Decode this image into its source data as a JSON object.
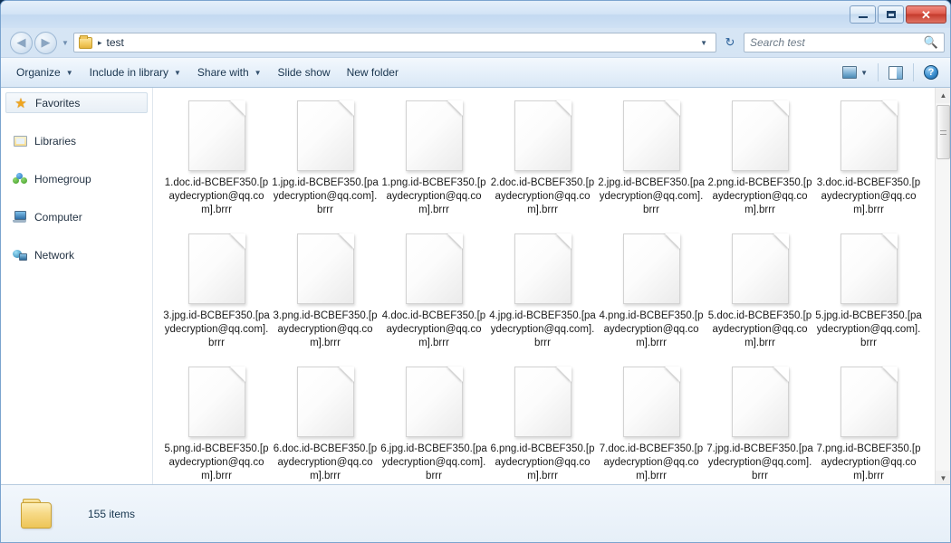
{
  "window": {
    "controls": {
      "minimize_label": "Minimize",
      "maximize_label": "Maximize",
      "close_label": "✕"
    }
  },
  "navigation": {
    "back_label": "◀",
    "forward_label": "▶",
    "history_caret": "▼",
    "refresh_label": "↻"
  },
  "address": {
    "folder_icon": "folder-icon",
    "separator": "▸",
    "crumb": "test",
    "dropdown_caret": "▼"
  },
  "search": {
    "placeholder": "Search test",
    "value": "",
    "icon": "search-icon"
  },
  "toolbar": {
    "organize_label": "Organize",
    "include_label": "Include in library",
    "share_label": "Share with",
    "slideshow_label": "Slide show",
    "newfolder_label": "New folder",
    "caret": "▼",
    "view_icon": "view-options-icon",
    "preview_icon": "preview-pane-icon",
    "help_icon": "help-icon",
    "help_glyph": "?"
  },
  "sidebar": {
    "items": [
      {
        "label": "Favorites",
        "icon": "star-icon",
        "selected": true
      },
      {
        "label": "Libraries",
        "icon": "library-icon",
        "selected": false
      },
      {
        "label": "Homegroup",
        "icon": "homegroup-icon",
        "selected": false
      },
      {
        "label": "Computer",
        "icon": "computer-icon",
        "selected": false
      },
      {
        "label": "Network",
        "icon": "network-icon",
        "selected": false
      }
    ]
  },
  "files": [
    {
      "name": "1.doc.id-BCBEF350.[paydecryption@qq.com].brrr",
      "icon": "blank-document-icon"
    },
    {
      "name": "1.jpg.id-BCBEF350.[paydecryption@qq.com].brrr",
      "icon": "blank-document-icon"
    },
    {
      "name": "1.png.id-BCBEF350.[paydecryption@qq.com].brrr",
      "icon": "blank-document-icon"
    },
    {
      "name": "2.doc.id-BCBEF350.[paydecryption@qq.com].brrr",
      "icon": "blank-document-icon"
    },
    {
      "name": "2.jpg.id-BCBEF350.[paydecryption@qq.com].brrr",
      "icon": "blank-document-icon"
    },
    {
      "name": "2.png.id-BCBEF350.[paydecryption@qq.com].brrr",
      "icon": "blank-document-icon"
    },
    {
      "name": "3.doc.id-BCBEF350.[paydecryption@qq.com].brrr",
      "icon": "blank-document-icon"
    },
    {
      "name": "3.jpg.id-BCBEF350.[paydecryption@qq.com].brrr",
      "icon": "blank-document-icon"
    },
    {
      "name": "3.png.id-BCBEF350.[paydecryption@qq.com].brrr",
      "icon": "blank-document-icon"
    },
    {
      "name": "4.doc.id-BCBEF350.[paydecryption@qq.com].brrr",
      "icon": "blank-document-icon"
    },
    {
      "name": "4.jpg.id-BCBEF350.[paydecryption@qq.com].brrr",
      "icon": "blank-document-icon"
    },
    {
      "name": "4.png.id-BCBEF350.[paydecryption@qq.com].brrr",
      "icon": "blank-document-icon"
    },
    {
      "name": "5.doc.id-BCBEF350.[paydecryption@qq.com].brrr",
      "icon": "blank-document-icon"
    },
    {
      "name": "5.jpg.id-BCBEF350.[paydecryption@qq.com].brrr",
      "icon": "blank-document-icon"
    },
    {
      "name": "5.png.id-BCBEF350.[paydecryption@qq.com].brrr",
      "icon": "blank-document-icon"
    },
    {
      "name": "6.doc.id-BCBEF350.[paydecryption@qq.com].brrr",
      "icon": "blank-document-icon"
    },
    {
      "name": "6.jpg.id-BCBEF350.[paydecryption@qq.com].brrr",
      "icon": "blank-document-icon"
    },
    {
      "name": "6.png.id-BCBEF350.[paydecryption@qq.com].brrr",
      "icon": "blank-document-icon"
    },
    {
      "name": "7.doc.id-BCBEF350.[paydecryption@qq.com].brrr",
      "icon": "blank-document-icon"
    },
    {
      "name": "7.jpg.id-BCBEF350.[paydecryption@qq.com].brrr",
      "icon": "blank-document-icon"
    },
    {
      "name": "7.png.id-BCBEF350.[paydecryption@qq.com].brrr",
      "icon": "blank-document-icon"
    }
  ],
  "scrollbar": {
    "up_arrow": "▲",
    "down_arrow": "▼"
  },
  "status": {
    "item_count_label": "155 items",
    "folder_icon": "folder-icon"
  }
}
